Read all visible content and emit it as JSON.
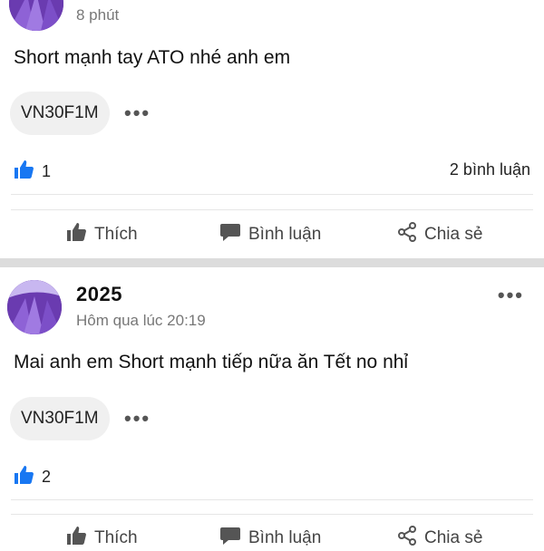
{
  "posts": [
    {
      "time": "8 phút",
      "content": "Short mạnh tay ATO nhé anh em",
      "tag": "VN30F1M",
      "likes": "1",
      "comments": "2 bình luận"
    },
    {
      "author": "2025",
      "time": "Hôm qua lúc 20:19",
      "content": "Mai anh em Short mạnh tiếp nữa ăn Tết no nhỉ",
      "tag": "VN30F1M",
      "likes": "2"
    }
  ],
  "actions": {
    "like": "Thích",
    "comment": "Bình luận",
    "share": "Chia sẻ"
  },
  "more_label": "•••",
  "icons": {
    "like": "thumbs-up-icon",
    "comment": "speech-bubble-icon",
    "share": "share-icon",
    "liked_badge": "blue-thumbs-up-icon"
  },
  "colors": {
    "accent_blue": "#1877f2",
    "muted_text": "#777777",
    "separator": "#dcdcdc"
  }
}
